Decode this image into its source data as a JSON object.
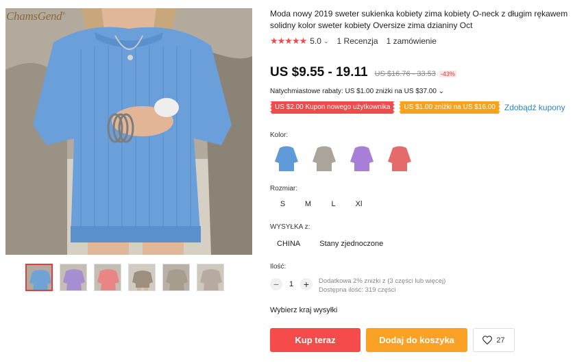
{
  "gallery": {
    "brand": "ChamsGend",
    "brand_mark": "®",
    "thumbnail_colors": [
      "#6fa3d6",
      "#a68fd0",
      "#e98585",
      "#9c8f80",
      "#a69d8f",
      "#b7aaa0"
    ]
  },
  "product": {
    "title": "Moda nowy 2019 sweter sukienka kobiety zima kobiety O-neck z długim rękawem solidny kolor sweter kobiety Oversize zima dzianiny Oct",
    "stars": "★★★★★",
    "rating": "5.0",
    "reviews": "1 Recenzja",
    "orders": "1 zamówienie",
    "price": "US $9.55 - 19.11",
    "old_price": "US $16.76 - 33.53",
    "discount": "-43%",
    "instant_discount": "Natychmiastowe rabaty: US $1.00 zniżki na US $37.00 ⌄",
    "coupons": [
      "US $2.00 Kupon nowego użytkownika",
      "US $1.00 zniżki na US $16.00"
    ],
    "get_coupons": "Zdobądź kupony"
  },
  "options": {
    "color_label": "Kolor:",
    "colors": [
      {
        "name": "blue",
        "hex": "#5f9bd8"
      },
      {
        "name": "gray",
        "hex": "#aaa49b"
      },
      {
        "name": "purple",
        "hex": "#a77fd6"
      },
      {
        "name": "red",
        "hex": "#e46b6b"
      }
    ],
    "size_label": "Rozmiar:",
    "sizes": [
      "S",
      "M",
      "L",
      "Xl"
    ],
    "shipping_label": "WYSYŁKA z:",
    "shipping_from": [
      "CHINA",
      "Stany zjednoczone"
    ],
    "quantity_label": "Ilość:",
    "quantity": "1",
    "quantity_minus": "−",
    "quantity_plus": "+",
    "quantity_note": "Dodatkowa 2% zniżki z (3 części lub więcej)",
    "stock": "Dostępna ilość: 319 części",
    "ship_country": "Wybierz kraj wysyłki"
  },
  "actions": {
    "buy_now": "Kup teraz",
    "add_to_cart": "Dodaj do koszyka",
    "wishlist_count": "27"
  },
  "colors": {
    "accent_red": "#f64b4b",
    "accent_orange": "#fba126",
    "link_blue": "#2e86c4"
  }
}
